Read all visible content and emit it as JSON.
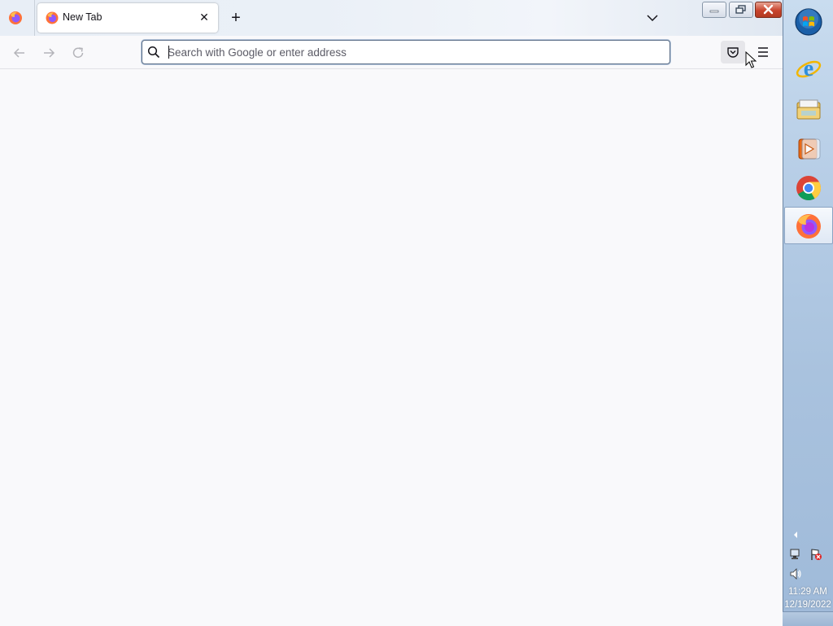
{
  "browser": {
    "tab": {
      "title": "New Tab",
      "close_symbol": "✕"
    },
    "new_tab_symbol": "+",
    "urlbar": {
      "placeholder": "Search with Google or enter address",
      "value": ""
    }
  },
  "taskbar": {
    "apps": [
      {
        "name": "start-button",
        "icon": "windows-start-orb"
      },
      {
        "name": "internet-explorer",
        "icon": "ie-icon"
      },
      {
        "name": "windows-explorer",
        "icon": "folder-icon"
      },
      {
        "name": "media-player",
        "icon": "media-player-icon"
      },
      {
        "name": "chrome",
        "icon": "chrome-icon"
      },
      {
        "name": "firefox",
        "icon": "firefox-icon",
        "active": true
      }
    ],
    "clock": {
      "time": "11:29 AM",
      "date": "12/19/2022"
    }
  },
  "colors": {
    "accent": "#0061e0",
    "content_bg": "#f9f9fb",
    "urlbar_border": "#5b6e87"
  }
}
